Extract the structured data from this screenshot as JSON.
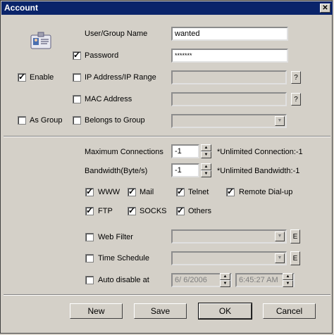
{
  "window": {
    "title": "Account",
    "close_icon": "close-icon"
  },
  "user": {
    "name_label": "User/Group Name",
    "name_value": "wanted",
    "password_label": "Password",
    "password_value": "*******",
    "enable_label": "Enable",
    "ip_label": "IP Address/IP Range",
    "mac_label": "MAC Address",
    "as_group_label": "As Group",
    "belongs_label": "Belongs to Group",
    "help_glyph": "?",
    "icon": "user-card-icon"
  },
  "limits": {
    "max_conn_label": "Maximum Connections",
    "max_conn_value": "-1",
    "max_conn_note": "*Unlimited Connection:-1",
    "bandwidth_label": "Bandwidth(Byte/s)",
    "bandwidth_value": "-1",
    "bandwidth_note": "*Unlimited Bandwidth:-1"
  },
  "services": [
    {
      "label": "WWW",
      "checked": true
    },
    {
      "label": "Mail",
      "checked": true
    },
    {
      "label": "Telnet",
      "checked": true
    },
    {
      "label": "Remote Dial-up",
      "checked": true
    },
    {
      "label": "FTP",
      "checked": true
    },
    {
      "label": "SOCKS",
      "checked": true
    },
    {
      "label": "Others",
      "checked": true
    }
  ],
  "filters": {
    "web_filter_label": "Web Filter",
    "time_schedule_label": "Time Schedule",
    "auto_disable_label": "Auto disable at",
    "date_value": "6/  6/2006",
    "time_value": "6:45:27 AM",
    "edit_glyph": "E"
  },
  "buttons": {
    "new": "New",
    "save": "Save",
    "ok": "OK",
    "cancel": "Cancel"
  }
}
